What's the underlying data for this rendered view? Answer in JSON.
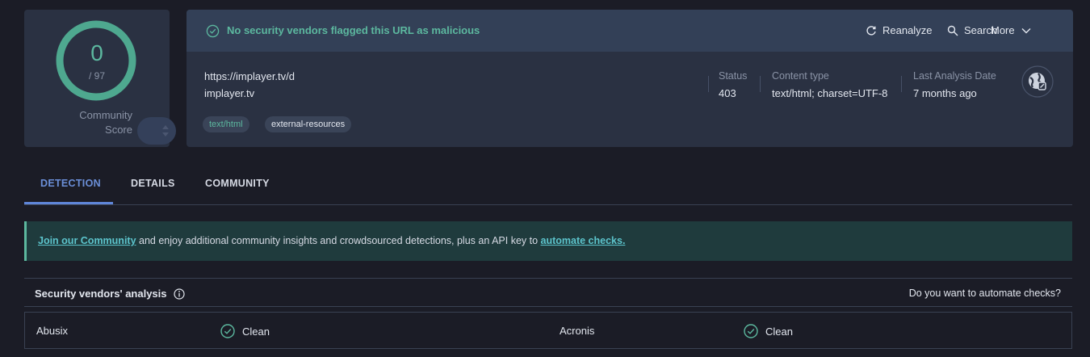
{
  "score": {
    "value": "0",
    "total": "/ 97",
    "community_label_1": "Community",
    "community_label_2": "Score"
  },
  "banner": {
    "message": "No security vendors flagged this URL as malicious"
  },
  "actions": {
    "reanalyze": "Reanalyze",
    "search": "Search",
    "more": "More"
  },
  "target": {
    "url": "https://implayer.tv/d",
    "domain": "implayer.tv",
    "tags": [
      "text/html",
      "external-resources"
    ]
  },
  "meta": {
    "status_label": "Status",
    "status_value": "403",
    "content_type_label": "Content type",
    "content_type_value": "text/html; charset=UTF-8",
    "last_analysis_label": "Last Analysis Date",
    "last_analysis_value": "7 months ago"
  },
  "tabs": [
    {
      "label": "DETECTION"
    },
    {
      "label": "DETAILS"
    },
    {
      "label": "COMMUNITY"
    }
  ],
  "notice": {
    "link1": "Join our Community",
    "middle": " and enjoy additional community insights and crowdsourced detections, plus an API key to ",
    "link2": "automate checks."
  },
  "analysis": {
    "title": "Security vendors' analysis",
    "automate_question": "Do you want to automate checks?"
  },
  "vendors": [
    {
      "name": "Abusix",
      "result": "Clean"
    },
    {
      "name": "Acronis",
      "result": "Clean"
    }
  ],
  "colors": {
    "accent_green": "#5cb89f",
    "accent_blue": "#5f86d9",
    "link": "#5cc4cc"
  }
}
